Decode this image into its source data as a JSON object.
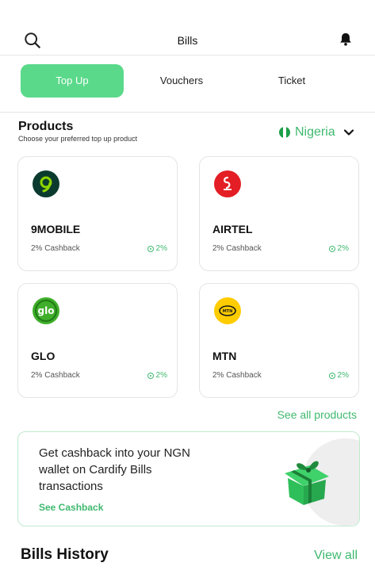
{
  "header": {
    "title": "Bills",
    "search_icon": "search-icon",
    "bell_icon": "bell-icon"
  },
  "tabs": [
    {
      "label": "Top Up",
      "active": true
    },
    {
      "label": "Vouchers",
      "active": false
    },
    {
      "label": "Ticket",
      "active": false
    }
  ],
  "products": {
    "heading": "Products",
    "subheading": "Choose your preferred top up product",
    "country": "Nigeria",
    "items": [
      {
        "name": "9MOBILE",
        "cashback": "2% Cashback",
        "percent": "2%",
        "logo_color": "#0b3b2e"
      },
      {
        "name": "AIRTEL",
        "cashback": "2% Cashback",
        "percent": "2%",
        "logo_color": "#e31e24"
      },
      {
        "name": "GLO",
        "cashback": "2% Cashback",
        "percent": "2%",
        "logo_color": "#3fae2a"
      },
      {
        "name": "MTN",
        "cashback": "2% Cashback",
        "percent": "2%",
        "logo_color": "#ffcc00"
      }
    ],
    "see_all": "See all products"
  },
  "promo": {
    "text": "Get cashback into your NGN wallet on Cardify Bills transactions",
    "link": "See Cashback"
  },
  "history": {
    "title": "Bills History",
    "view_all": "View all"
  },
  "colors": {
    "accent": "#5ad98a",
    "accent_text": "#3fb96f"
  }
}
